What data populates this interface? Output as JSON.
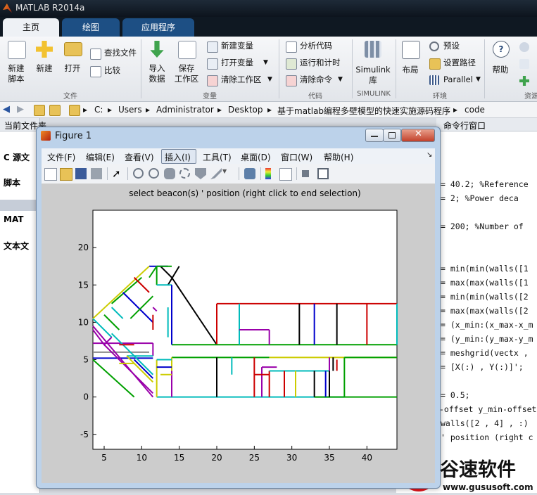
{
  "app": {
    "title": "MATLAB R2014a"
  },
  "tabs": [
    {
      "label": "主页",
      "active": true
    },
    {
      "label": "绘图",
      "active": false
    },
    {
      "label": "应用程序",
      "active": false
    }
  ],
  "ribbon": {
    "new_script": "新建\n脚本",
    "new": "新建",
    "open": "打开",
    "find_files": "查找文件",
    "compare": "比较",
    "group_file": "文件",
    "import_data": "导入\n数据",
    "save_workspace": "保存\n工作区",
    "new_variable": "新建变量",
    "open_variable": "打开变量",
    "clear_workspace": "清除工作区",
    "group_variable": "变量",
    "analyze_code": "分析代码",
    "run_and_time": "运行和计时",
    "clear_commands": "清除命令",
    "group_code": "代码",
    "simulink": "Simulink\n库",
    "group_simulink": "SIMULINK",
    "layout": "布局",
    "preferences": "预设",
    "set_path": "设置路径",
    "parallel": "Parallel",
    "group_env": "环境",
    "help": "帮助",
    "group_resources": "资源"
  },
  "address": {
    "segments": [
      "C:",
      "Users",
      "Administrator",
      "Desktop",
      "基于matlab编程多壁模型的快速实施源码程序",
      "code"
    ]
  },
  "left_panel": {
    "header": "当前文件夹",
    "items": [
      "C 源文",
      "脚本",
      "MAT",
      "文本文"
    ]
  },
  "command_header": "命令行窗口",
  "code_lines": [
    "= 40.2; %Reference",
    "= 2;    %Power deca",
    "= 200;  %Number of",
    "= min(min(walls([1",
    "= max(max(walls([1",
    "= min(min(walls([2",
    "= max(max(walls([2",
    "= (x_min:(x_max-x_m",
    "= (y_min:(y_max-y_m",
    "= meshgrid(vectx ,",
    "= [X(:) , Y(:)]';",
    "= 0.5;",
    "-offset y_min-offset",
    " walls([2 , 4] , :)",
    "' position (right c"
  ],
  "figure": {
    "title": "Figure 1",
    "menu": [
      "文件(F)",
      "编辑(E)",
      "查看(V)",
      "插入(I)",
      "工具(T)",
      "桌面(D)",
      "窗口(W)",
      "帮助(H)"
    ],
    "plot_title": "select beacon(s) ' position (right click to end selection)"
  },
  "chart_data": {
    "type": "line",
    "title": "select beacon(s) ' position (right click to end selection)",
    "xlim": [
      3.5,
      44
    ],
    "ylim": [
      -7,
      25
    ],
    "xticks": [
      5,
      10,
      15,
      20,
      25,
      30,
      35,
      40
    ],
    "yticks": [
      -5,
      0,
      5,
      10,
      15,
      20
    ],
    "walls": [
      {
        "c": "#8a8a8a",
        "x": [
          3.5,
          11
        ],
        "y": [
          6,
          6
        ]
      },
      {
        "c": "#000000",
        "x": [
          14,
          20
        ],
        "y": [
          16,
          7
        ]
      },
      {
        "c": "#000000",
        "x": [
          12.5,
          14
        ],
        "y": [
          17.5,
          16
        ]
      },
      {
        "c": "#000000",
        "x": [
          15,
          13.5
        ],
        "y": [
          17.5,
          15
        ]
      },
      {
        "c": "#0000cc",
        "x": [
          11,
          13.5
        ],
        "y": [
          17.5,
          17.5
        ]
      },
      {
        "c": "#00a000",
        "x": [
          12,
          14
        ],
        "y": [
          17.5,
          17.5
        ]
      },
      {
        "c": "#00a000",
        "x": [
          12,
          12
        ],
        "y": [
          17.5,
          15
        ]
      },
      {
        "c": "#00bbbb",
        "x": [
          12,
          14
        ],
        "y": [
          15,
          15
        ]
      },
      {
        "c": "#cc0000",
        "x": [
          20,
          44
        ],
        "y": [
          12.5,
          12.5
        ]
      },
      {
        "c": "#cc0000",
        "x": [
          20,
          20
        ],
        "y": [
          12.5,
          7
        ]
      },
      {
        "c": "#00a000",
        "x": [
          14,
          44
        ],
        "y": [
          7,
          7
        ]
      },
      {
        "c": "#00bbbb",
        "x": [
          23,
          23
        ],
        "y": [
          12.5,
          7
        ]
      },
      {
        "c": "#9900aa",
        "x": [
          23,
          27
        ],
        "y": [
          9,
          9
        ]
      },
      {
        "c": "#9900aa",
        "x": [
          27,
          27
        ],
        "y": [
          9,
          7
        ]
      },
      {
        "c": "#000000",
        "x": [
          31,
          31
        ],
        "y": [
          12.5,
          7
        ]
      },
      {
        "c": "#0000cc",
        "x": [
          33,
          33
        ],
        "y": [
          12.5,
          7
        ]
      },
      {
        "c": "#000000",
        "x": [
          36,
          36
        ],
        "y": [
          12.5,
          7
        ]
      },
      {
        "c": "#cc0000",
        "x": [
          40,
          40
        ],
        "y": [
          12.5,
          7
        ]
      },
      {
        "c": "#00bbbb",
        "x": [
          44,
          44
        ],
        "y": [
          12.5,
          7
        ]
      },
      {
        "c": "#0000cc",
        "x": [
          14,
          14
        ],
        "y": [
          15,
          7
        ]
      },
      {
        "c": "#00bbbb",
        "x": [
          13.5,
          13.5
        ],
        "y": [
          12,
          8
        ]
      },
      {
        "c": "#00a000",
        "x": [
          14,
          27
        ],
        "y": [
          5.3,
          5.3
        ]
      },
      {
        "c": "#cccc00",
        "x": [
          27,
          44
        ],
        "y": [
          5.3,
          5.3
        ]
      },
      {
        "c": "#00a000",
        "x": [
          37,
          44
        ],
        "y": [
          5.3,
          5.3
        ]
      },
      {
        "c": "#00bbbb",
        "x": [
          12,
          37
        ],
        "y": [
          0,
          0
        ]
      },
      {
        "c": "#00a000",
        "x": [
          33,
          44
        ],
        "y": [
          0,
          0
        ]
      },
      {
        "c": "#000000",
        "x": [
          20,
          20
        ],
        "y": [
          5.3,
          0
        ]
      },
      {
        "c": "#cccc00",
        "x": [
          14,
          14
        ],
        "y": [
          5.3,
          0
        ]
      },
      {
        "c": "#9900aa",
        "x": [
          14,
          14
        ],
        "y": [
          3.5,
          0
        ]
      },
      {
        "c": "#cc0000",
        "x": [
          25,
          25
        ],
        "y": [
          5.3,
          0
        ]
      },
      {
        "c": "#9900aa",
        "x": [
          26,
          26
        ],
        "y": [
          4,
          0
        ]
      },
      {
        "c": "#9900aa",
        "x": [
          26,
          28
        ],
        "y": [
          4,
          4
        ]
      },
      {
        "c": "#cc0000",
        "x": [
          25,
          27
        ],
        "y": [
          3,
          3
        ]
      },
      {
        "c": "#cc0000",
        "x": [
          27,
          27
        ],
        "y": [
          3.5,
          0
        ]
      },
      {
        "c": "#00bbbb",
        "x": [
          27,
          35
        ],
        "y": [
          3.5,
          3.5
        ]
      },
      {
        "c": "#cc0000",
        "x": [
          29,
          29
        ],
        "y": [
          3.5,
          0
        ]
      },
      {
        "c": "#cccc00",
        "x": [
          30.5,
          30.5
        ],
        "y": [
          3.5,
          0
        ]
      },
      {
        "c": "#000000",
        "x": [
          33,
          33
        ],
        "y": [
          3.5,
          0
        ]
      },
      {
        "c": "#0000cc",
        "x": [
          34.5,
          34.5
        ],
        "y": [
          3.5,
          0
        ]
      },
      {
        "c": "#000000",
        "x": [
          35,
          35
        ],
        "y": [
          3.5,
          0
        ]
      },
      {
        "c": "#00a000",
        "x": [
          37,
          37
        ],
        "y": [
          5.3,
          0
        ]
      },
      {
        "c": "#9900aa",
        "x": [
          35,
          35
        ],
        "y": [
          5.3,
          3.5
        ]
      },
      {
        "c": "#000000",
        "x": [
          35.5,
          35.5
        ],
        "y": [
          5.3,
          3.5
        ]
      },
      {
        "c": "#cc0000",
        "x": [
          36,
          36
        ],
        "y": [
          5,
          3.5
        ]
      },
      {
        "c": "#00bbbb",
        "x": [
          22,
          22
        ],
        "y": [
          5.3,
          3
        ]
      },
      {
        "c": "#cccc00",
        "x": [
          12,
          12
        ],
        "y": [
          5,
          0
        ]
      },
      {
        "c": "#00bbbb",
        "x": [
          12,
          14
        ],
        "y": [
          5,
          5
        ]
      },
      {
        "c": "#0000cc",
        "x": [
          12,
          14
        ],
        "y": [
          4,
          4
        ]
      },
      {
        "c": "#cccc00",
        "x": [
          12.5,
          14
        ],
        "y": [
          3,
          3
        ]
      },
      {
        "c": "#9900aa",
        "x": [
          3.5,
          11.5
        ],
        "y": [
          7.2,
          7.2
        ]
      },
      {
        "c": "#9900aa",
        "x": [
          11.5,
          11.5
        ],
        "y": [
          7.2,
          5.5
        ]
      },
      {
        "c": "#00bbbb",
        "x": [
          8,
          11.5
        ],
        "y": [
          5.5,
          5.5
        ]
      },
      {
        "c": "#0000cc",
        "x": [
          3.5,
          11.5
        ],
        "y": [
          5.2,
          5.2
        ]
      },
      {
        "c": "#00a000",
        "x": [
          3.5,
          9
        ],
        "y": [
          5,
          0
        ]
      },
      {
        "c": "#0000cc",
        "x": [
          9,
          11.5
        ],
        "y": [
          5,
          2.5
        ]
      },
      {
        "c": "#9900aa",
        "x": [
          5,
          11.5
        ],
        "y": [
          7,
          0.5
        ]
      },
      {
        "c": "#00bbbb",
        "x": [
          6,
          11.5
        ],
        "y": [
          8.5,
          3
        ]
      },
      {
        "c": "#cccc00",
        "x": [
          8,
          11.5
        ],
        "y": [
          5.5,
          2
        ]
      },
      {
        "c": "#9900aa",
        "x": [
          3.5,
          11.5
        ],
        "y": [
          9.5,
          0
        ]
      },
      {
        "c": "#00bbbb",
        "x": [
          3.5,
          6
        ],
        "y": [
          10.5,
          8
        ]
      },
      {
        "c": "#9900aa",
        "x": [
          5,
          6
        ],
        "y": [
          7,
          8
        ]
      },
      {
        "c": "#cccc00",
        "x": [
          3.5,
          11
        ],
        "y": [
          10.5,
          17.5
        ]
      },
      {
        "c": "#00a000",
        "x": [
          6,
          10
        ],
        "y": [
          12.5,
          16
        ]
      },
      {
        "c": "#0000cc",
        "x": [
          7.5,
          11.5
        ],
        "y": [
          14,
          10
        ]
      },
      {
        "c": "#00bbbb",
        "x": [
          6,
          7.5
        ],
        "y": [
          12,
          10.5
        ]
      },
      {
        "c": "#cc0000",
        "x": [
          9,
          11
        ],
        "y": [
          16,
          14
        ]
      },
      {
        "c": "#00a000",
        "x": [
          11,
          12
        ],
        "y": [
          16,
          17.5
        ]
      },
      {
        "c": "#cc0000",
        "x": [
          11.5,
          11.5
        ],
        "y": [
          11,
          9
        ]
      },
      {
        "c": "#9900aa",
        "x": [
          11.5,
          12
        ],
        "y": [
          12,
          11.5
        ]
      },
      {
        "c": "#00a000",
        "x": [
          8.5,
          11.5
        ],
        "y": [
          10.5,
          13.5
        ]
      },
      {
        "c": "#cc0000",
        "x": [
          7,
          9
        ],
        "y": [
          7,
          7
        ]
      },
      {
        "c": "#cccc00",
        "x": [
          7,
          9
        ],
        "y": [
          4.5,
          4.5
        ]
      },
      {
        "c": "#9900aa",
        "x": [
          3.5,
          5
        ],
        "y": [
          9,
          7
        ]
      },
      {
        "c": "#00a000",
        "x": [
          5,
          7
        ],
        "y": [
          11,
          9
        ]
      }
    ]
  }
}
